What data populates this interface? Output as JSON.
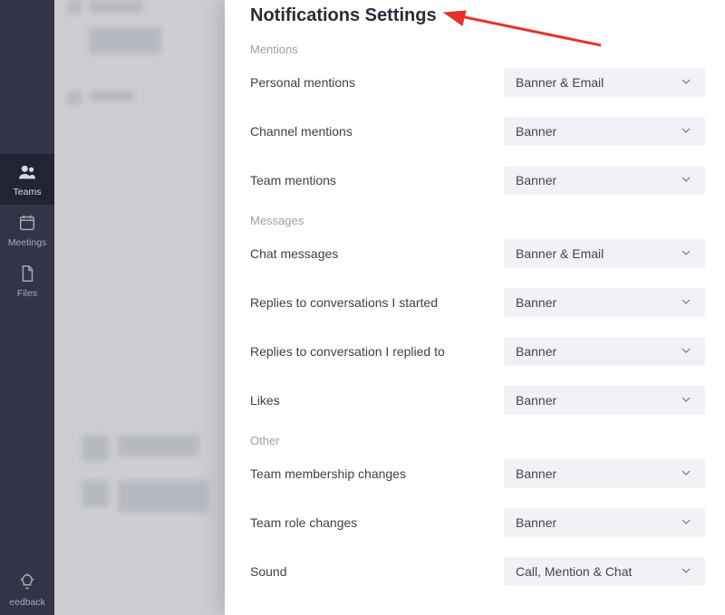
{
  "rail": {
    "items": [
      {
        "name": "teams",
        "label": "Teams",
        "active": true
      },
      {
        "name": "meetings",
        "label": "Meetings",
        "active": false
      },
      {
        "name": "files",
        "label": "Files",
        "active": false
      }
    ],
    "feedback_label": "eedback"
  },
  "panel": {
    "title": "Notifications Settings",
    "sections": [
      {
        "label": "Mentions",
        "rows": [
          {
            "label": "Personal mentions",
            "value": "Banner & Email"
          },
          {
            "label": "Channel mentions",
            "value": "Banner"
          },
          {
            "label": "Team mentions",
            "value": "Banner"
          }
        ]
      },
      {
        "label": "Messages",
        "rows": [
          {
            "label": "Chat messages",
            "value": "Banner & Email"
          },
          {
            "label": "Replies to conversations I started",
            "value": "Banner"
          },
          {
            "label": "Replies to conversation I replied to",
            "value": "Banner"
          },
          {
            "label": "Likes",
            "value": "Banner"
          }
        ]
      },
      {
        "label": "Other",
        "rows": [
          {
            "label": "Team membership changes",
            "value": "Banner"
          },
          {
            "label": "Team role changes",
            "value": "Banner"
          },
          {
            "label": "Sound",
            "value": "Call, Mention & Chat"
          }
        ]
      }
    ]
  }
}
